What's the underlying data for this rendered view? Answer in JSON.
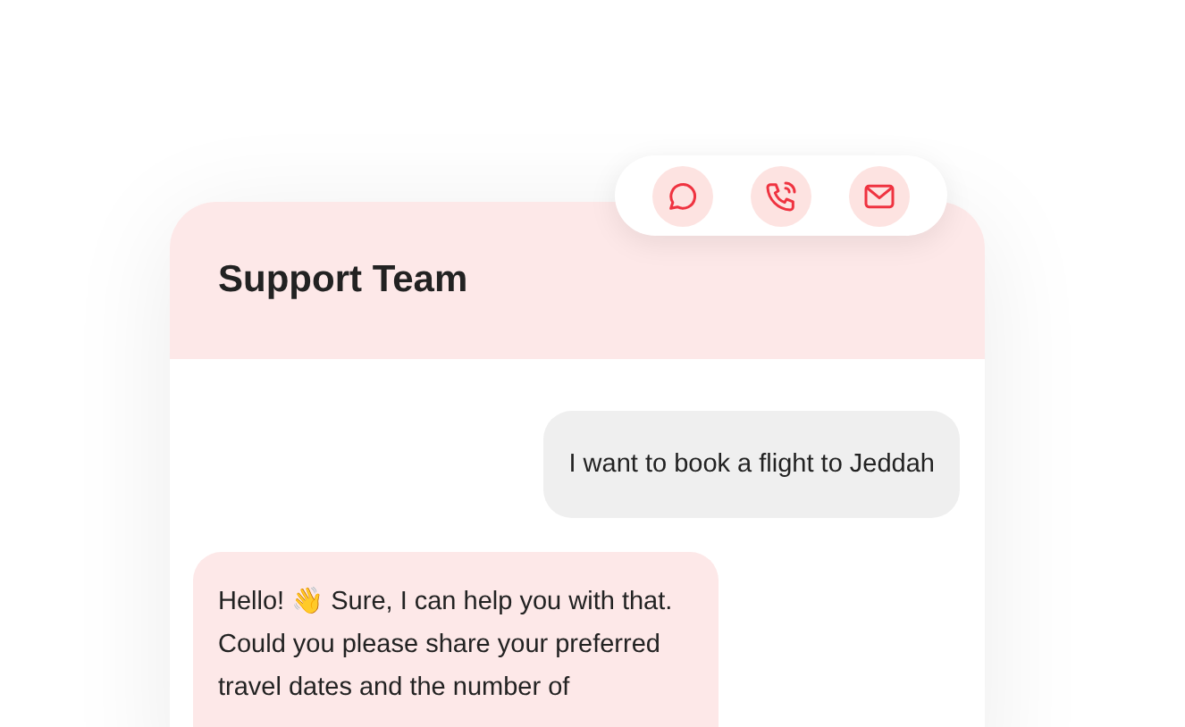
{
  "contact_actions": [
    {
      "kind": "chat"
    },
    {
      "kind": "call"
    },
    {
      "kind": "email"
    }
  ],
  "header": {
    "title": "Support Team"
  },
  "messages": [
    {
      "kind": "outgoing",
      "text": "I want to book a flight to Jeddah"
    },
    {
      "kind": "incoming",
      "text": "Hello! 👋 Sure, I can help you with that. Could you please share your preferred travel dates and the number of"
    }
  ]
}
